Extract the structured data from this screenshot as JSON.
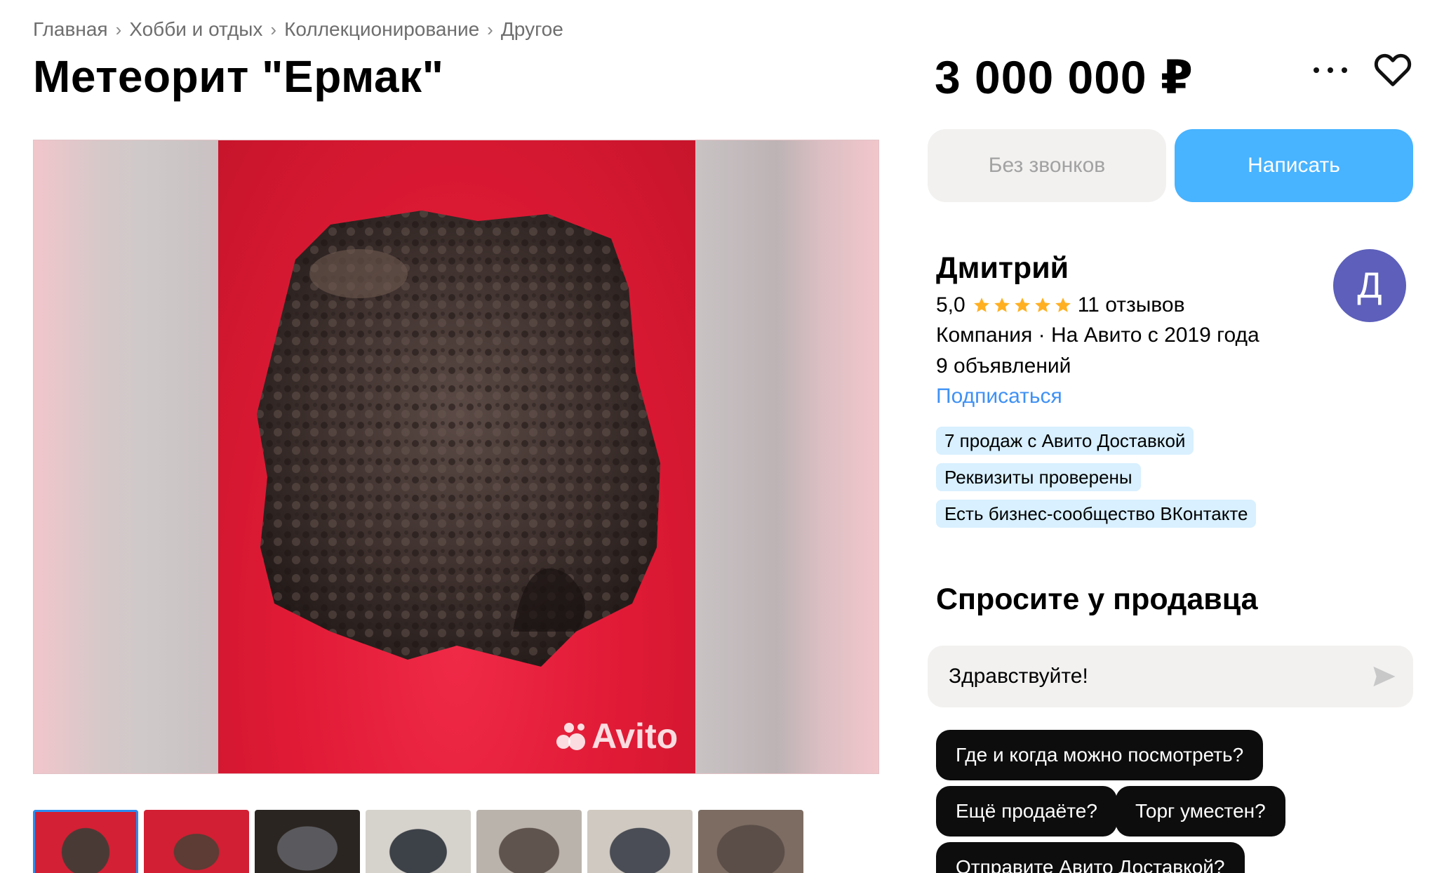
{
  "breadcrumb": [
    "Главная",
    "Хобби и отдых",
    "Коллекционирование",
    "Другое"
  ],
  "listing": {
    "title": "Метеорит \"Ермак\"",
    "price": "3 000 000 ₽"
  },
  "actions": {
    "no_calls_label": "Без звонков",
    "write_label": "Написать"
  },
  "gallery": {
    "watermark": "Avito",
    "thumbnail_count": 7,
    "active_thumbnail": 1
  },
  "seller": {
    "name": "Дмитрий",
    "rating": "5,0",
    "stars": 5,
    "reviews": "11 отзывов",
    "meta": "Компания · На Авито с 2019 года",
    "listings": "9 объявлений",
    "subscribe_label": "Подписаться",
    "avatar_letter": "Д",
    "badges": [
      "7 продаж с Авито Доставкой",
      "Реквизиты проверены",
      "Есть бизнес-сообщество ВКонтакте"
    ]
  },
  "ask": {
    "title": "Спросите у продавца",
    "message_value": "Здравствуйте!",
    "quick_questions": [
      "Где и когда можно посмотреть?",
      "Ещё продаёте?",
      "Торг уместен?",
      "Отправите Авито Доставкой?"
    ]
  },
  "colors": {
    "accent_blue": "#48b3ff",
    "link_blue": "#3f91f5",
    "badge_bg": "#d8f0ff",
    "star": "#ffb021",
    "avatar_bg": "#5d5fba"
  }
}
